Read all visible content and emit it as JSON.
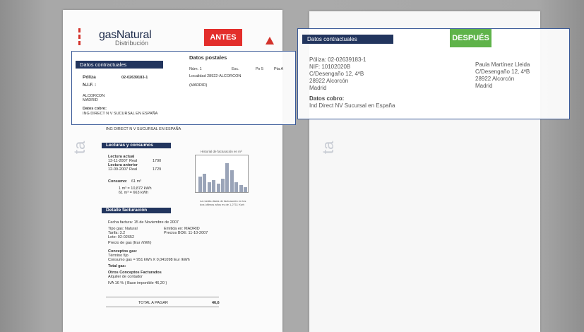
{
  "before": {
    "logo": {
      "brand": "gasNatural",
      "sub": "Distribución"
    },
    "badge": "ANTES",
    "contract_header": "Datos contractuales",
    "poliza_label": "Póliza",
    "poliza_value": "02-02639183-1",
    "nif_label": "N.I.F. :",
    "town": "ALCORCON",
    "province": "MADRID",
    "cobro_label": "Datos cobro:",
    "cobro_value": "ING DIRECT N V SUCURSAL EN ESPAÑA",
    "postal_header": "Datos postales",
    "postal_num": "Núm.  1",
    "postal_esc": "Esc.",
    "postal_ps": "Ps  5",
    "postal_pta": "Pta  A",
    "postal_localidad": "Localidad   28922-ALCORCON",
    "postal_madrid": "(MADRID)",
    "bank_line": "ING DIRECT N V SUCURSAL EN ESPAÑA",
    "side_text": "ta",
    "lecturas_header": "Lecturas y consumos",
    "lecturas": {
      "actual_label": "Lectura actual",
      "actual_date": "13-11-2007",
      "actual_type": "Real",
      "actual_value": "1790",
      "anterior_label": "Lectura anterior",
      "anterior_date": "12-09-2007",
      "anterior_type": "Real",
      "anterior_value": "1729",
      "consumo_label": "Consumo:",
      "consumo_value": "61 m³",
      "line1": "1 m³ =   10,872 kWh",
      "line2": "61 m³ =   663 kWh"
    },
    "hist_title": "Historial de facturación en m³",
    "hist_caption": "La media diaria de facturación en los dos últimos años es de 1,2711 Kwh",
    "detalle_header": "Detalle facturación",
    "detalle": {
      "fecha": "Fecha factura:      15 de Noviembre de 2007",
      "tipo_gas": "Tipo gas:    Natural",
      "tarifa": "Tarifa:      3.2",
      "lote": "Lote:        02-02652",
      "emitida": "Emitida en:      MADRID",
      "precios": "Precios BOE:    11-10-2007",
      "precio_gas": "Precio de gas (Eur /kWh)",
      "conceptos_gas": "Conceptos gas:",
      "termino_fijo": "Término fijo",
      "consumo_gas": "Consumo gas = 951 kWh X 0,041098 Eur /kWh",
      "total_gas": "Total gas:",
      "otros": "Otros Conceptos Facturados",
      "alquiler": "Alquiler de contador",
      "iva": "IVA 16 % ( Base imponible       46,20 )",
      "total_label": "TOTAL A PAGAR",
      "total_value": "46,6"
    }
  },
  "after": {
    "badge": "DESPUÉS",
    "contract_header": "Datos contractuales",
    "poliza": "Póliza: 02-02639183-1",
    "nif": "NIF: 10102020B",
    "addr1": "C/Desengaño 12, 4ºB",
    "addr2": "28922 Alcorcón",
    "addr3": "Madrid",
    "cobro_label": "Datos cobro:",
    "cobro_value": "Ind Direct NV Sucursal en España",
    "name": "Paula Martínez Lleida",
    "r_addr1": "C/Desengaño 12, 4ºB",
    "r_addr2": "28922 Alcorcón",
    "r_addr3": "Madrid",
    "side_text": "ta"
  },
  "colors": {
    "antes": "#e32e2b",
    "despues": "#5fb34a",
    "header": "#22355e",
    "frame": "#3a5a98"
  },
  "histogram": [
    0.45,
    0.55,
    0.3,
    0.35,
    0.25,
    0.4,
    0.85,
    0.65,
    0.3,
    0.2,
    0.15
  ]
}
